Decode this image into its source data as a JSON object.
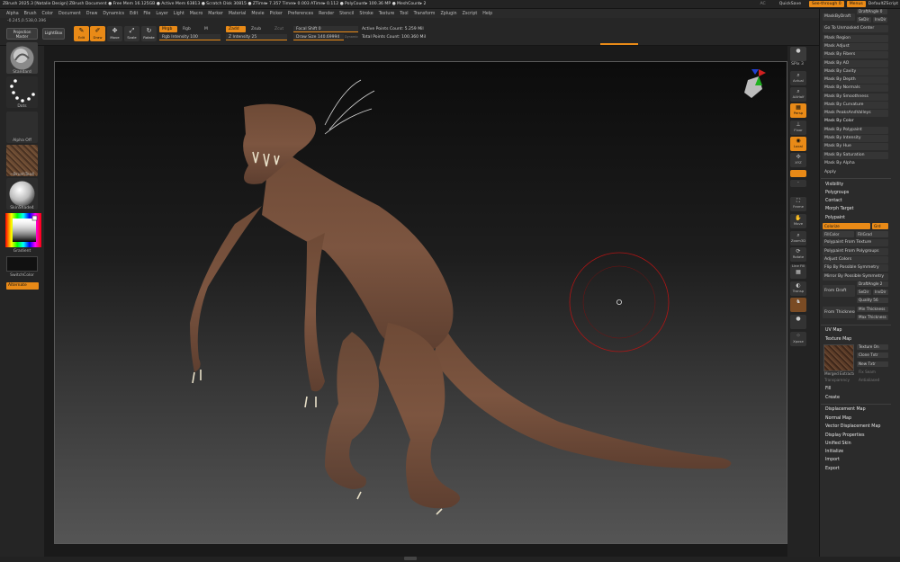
{
  "titlebar": {
    "title": "ZBrush 2025.3 [Natalie Design]   ZBrush Document     ● Free Mem 16.125GB ● Active Mem 63813 ● Scratch Disk 30815 ● ZTime▸ 7.357 Timer▸ 0.003 ATime▸ 0.112 ● PolyCount▸ 100.36 MP  ● MeshCount▸ 2",
    "ac": "AC",
    "quicksave": "QuickSave",
    "see_through": "See-through  0",
    "menus": "Menus",
    "default_script": "DefaultZScript"
  },
  "menu": [
    "Alpha",
    "Brush",
    "Color",
    "Document",
    "Draw",
    "Dynamics",
    "Edit",
    "File",
    "Layer",
    "Light",
    "Macro",
    "Marker",
    "Material",
    "Movie",
    "Picker",
    "Preferences",
    "Render",
    "Stencil",
    "Stroke",
    "Texture",
    "Tool",
    "Transform",
    "Zplugin",
    "Zscript",
    "Help"
  ],
  "toolbar": {
    "coords": "-0.245,0.538,0.396",
    "projection_master": "Projection Master",
    "lightbox": "LightBox",
    "edit": "Edit",
    "draw": "Draw",
    "move": "Move",
    "scale": "Scale",
    "rotate": "Rotate",
    "mrgb": "Mrgb",
    "rgb": "Rgb",
    "m": "M",
    "rgb_intensity": "Rgb Intensity 100",
    "zadd": "Zadd",
    "zsub": "Zsub",
    "zcut": "Zcut",
    "z_intensity": "Z Intensity 25",
    "focal_shift": "Focal Shift 0",
    "draw_size": "Draw Size 140.69994",
    "dynamic": "Dynamic",
    "active_points": "Active Points Count: 5.259 Mil",
    "total_points": "Total Points Count: 100.360 Mil"
  },
  "left": {
    "standard": "Standard",
    "dots": "Dots",
    "alpha_off": "Alpha Off",
    "brush_tex": "~BrushTex4",
    "skin_shade": "SkinShade4",
    "gradient": "Gradient",
    "switch_color": "SwitchColor",
    "alternate": "Alternate"
  },
  "rightstrip": {
    "spix": "SPix 3",
    "actual": "Actual",
    "aahalf": "AAHalf",
    "persp": "Persp",
    "floor": "Floor",
    "local": "Local",
    "xyz": "XYZ",
    "frame": "Frame",
    "move": "Move",
    "zoom3d": "Zoom3D",
    "rotate": "Rotate",
    "line_fill": "Line Fill",
    "polyf": "PolyF",
    "transp": "Transp",
    "solo": "Solo",
    "xpose": "Xpose"
  },
  "rightpanel": {
    "mask_by_draft": "MaskByDraft",
    "draft_angle": "DraftAngle 0",
    "sedir": "SeDir",
    "invdir": "InvDir",
    "go_to_unmasked": "Go To Unmasked Center",
    "mask_items": [
      "Mask Region",
      "Mask Adjust",
      "Mask By Fibers",
      "Mask By AO",
      "Mask By Cavity",
      "Mask By Depth",
      "Mask By Normals",
      "Mask By Smoothness",
      "Mask By Curvature",
      "Mask PeaksAndValleys",
      "Mask By Color",
      "Mask By Polypaint",
      "Mask By Intensity",
      "Mask By Hue",
      "Mask By Saturation",
      "Mask By Alpha",
      "Apply"
    ],
    "visibility": "Visibility",
    "polygroups": "Polygroups",
    "contact": "Contact",
    "morph_target": "Morph Target",
    "polypaint": "Polypaint",
    "colorize": "Colorize",
    "grd": "Grd",
    "fill_color": "FillColor",
    "fill_grad": "FillGrad",
    "polypaint_from_texture": "Polypaint From Texture",
    "polypaint_from_polygroups": "Polypaint From Polygroups",
    "adjust_colors": "Adjust Colors",
    "flip_by_possible": "Flip By Possible Symmetry",
    "mirror_by_possible": "Mirror By Possible Symmetry",
    "from_draft": "From Draft",
    "draft_angle2": "DraftAngle 2",
    "sedir2": "SeDir",
    "invdir2": "InvDir",
    "quality": "Quality 56",
    "from_thickness": "From Thickness",
    "min_thickness": "Min Thickness",
    "max_thickness": "Max Thickness",
    "uv_map": "UV Map",
    "texture_map": "Texture Map",
    "texture_on": "Texture On",
    "clone_txtr": "Clone Txtr",
    "new_txtr": "New Txtr",
    "merged_extractor": "Merged Extractor",
    "fix_seam": "Fix Seam",
    "transparency": "Transparency",
    "antialiased": "Antialiased",
    "fill": "Fill",
    "create": "Create",
    "bottom_items": [
      "Displacement Map",
      "Normal Map",
      "Vector Displacement Map",
      "Display Properties",
      "Unified Skin",
      "Initialize",
      "Import",
      "Export"
    ]
  },
  "colors": {
    "accent": "#e98a17",
    "brush_ring": "#c01818"
  }
}
